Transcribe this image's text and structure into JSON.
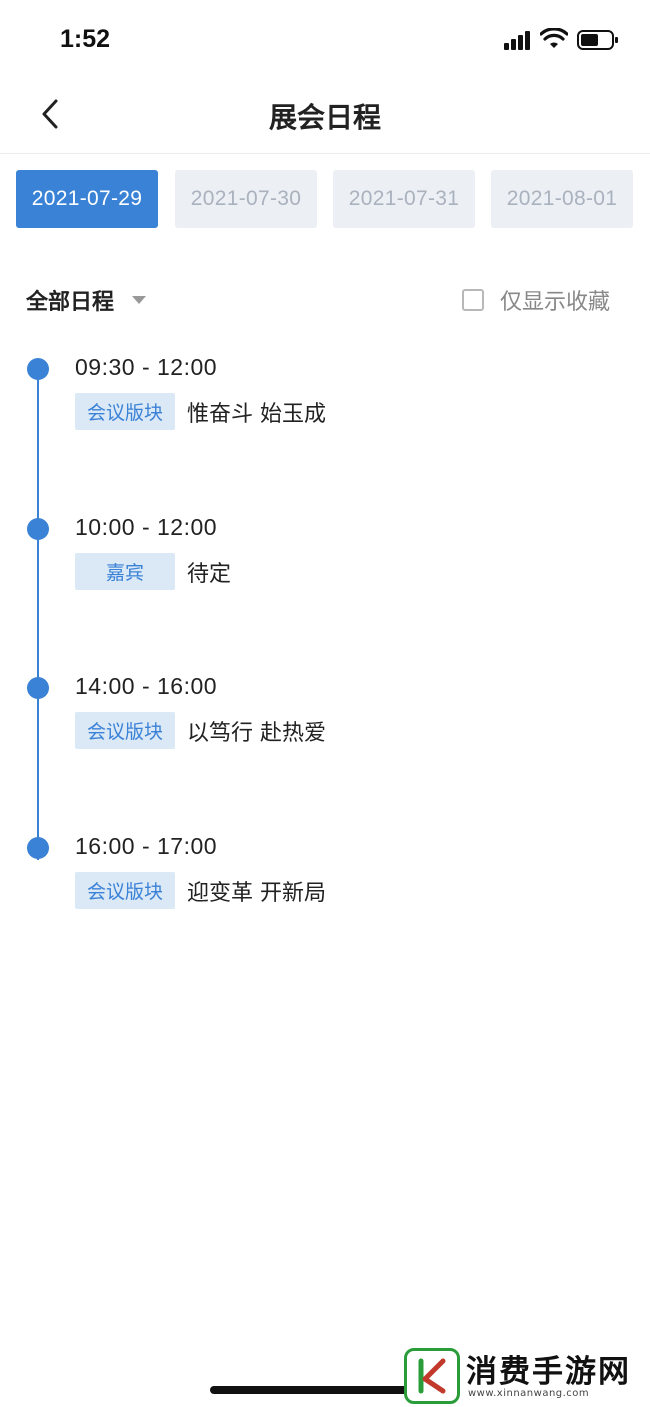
{
  "status_bar": {
    "time": "1:52"
  },
  "header": {
    "title": "展会日程",
    "back_icon": "chevron-left-icon"
  },
  "dates": [
    {
      "label": "2021-07-29",
      "active": true
    },
    {
      "label": "2021-07-30",
      "active": false
    },
    {
      "label": "2021-07-31",
      "active": false
    },
    {
      "label": "2021-08-01",
      "active": false
    }
  ],
  "filter": {
    "label": "全部日程",
    "favorites_label": "仅显示收藏",
    "favorites_checked": false
  },
  "events": [
    {
      "time": "09:30 - 12:00",
      "tag": "会议版块",
      "title": "惟奋斗 始玉成"
    },
    {
      "time": "10:00 - 12:00",
      "tag": "嘉宾",
      "title": "待定"
    },
    {
      "time": "14:00 - 16:00",
      "tag": "会议版块",
      "title": "以笃行 赴热爱"
    },
    {
      "time": "16:00 - 17:00",
      "tag": "会议版块",
      "title": "迎变革 开新局"
    }
  ],
  "watermark": {
    "text": "消费手游网",
    "url": "www.xinnanwang.com"
  },
  "colors": {
    "accent": "#3a82d6",
    "tag_bg": "#dbe8f6",
    "inactive_tab_bg": "#eceff4",
    "inactive_tab_text": "#aab2be"
  }
}
